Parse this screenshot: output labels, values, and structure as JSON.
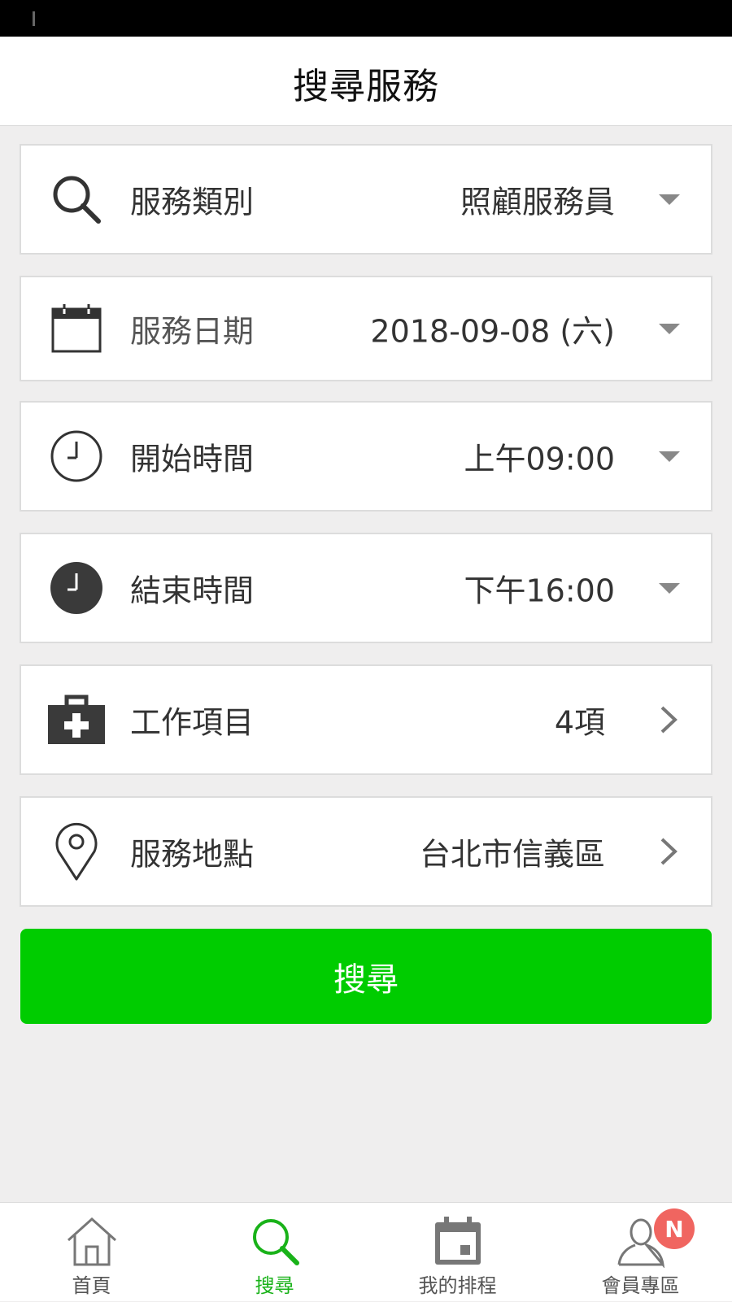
{
  "page_title": "搜尋服務",
  "fields": {
    "category": {
      "label": "服務類別",
      "value": "照顧服務員"
    },
    "date": {
      "label": "服務日期",
      "value": "2018-09-08 (六)"
    },
    "start_time": {
      "label": "開始時間",
      "value": "上午09:00"
    },
    "end_time": {
      "label": "結束時間",
      "value": "下午16:00"
    },
    "work_items": {
      "label": "工作項目",
      "value": "4項"
    },
    "location": {
      "label": "服務地點",
      "value": "台北市信義區"
    }
  },
  "search_button": "搜尋",
  "tabs": [
    {
      "label": "首頁",
      "icon": "home-icon",
      "active": false
    },
    {
      "label": "搜尋",
      "icon": "search-icon",
      "active": true
    },
    {
      "label": "我的排程",
      "icon": "calendar-icon",
      "active": false
    },
    {
      "label": "會員專區",
      "icon": "user-icon",
      "active": false
    }
  ],
  "member_badge": "N",
  "colors": {
    "accent": "#00cc00",
    "active_tab": "#19b219",
    "badge": "#f06560",
    "background": "#efeeee"
  }
}
